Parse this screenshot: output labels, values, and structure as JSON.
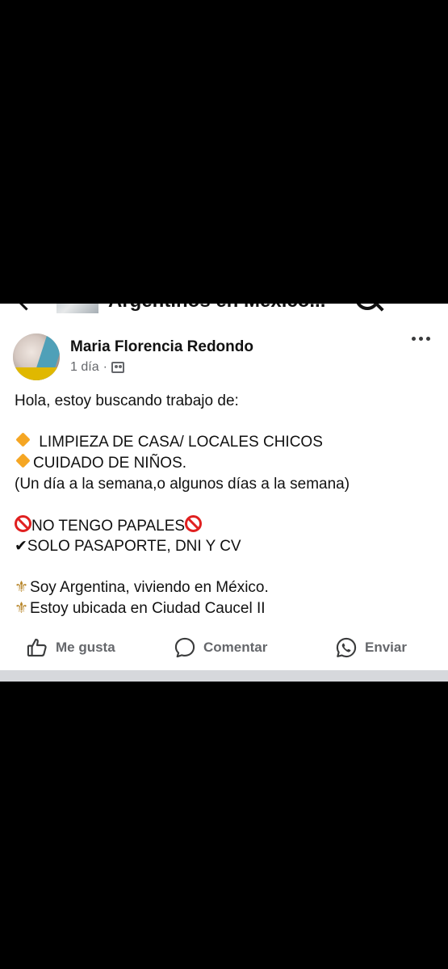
{
  "group": {
    "name": "Argentinos en México..."
  },
  "post": {
    "author": "Maria Florencia Redondo",
    "time": "1 día",
    "separator": "·",
    "body_lines": {
      "intro": "Hola, estoy buscando trabajo de:",
      "item1": "LIMPIEZA DE CASA/ LOCALES CHICOS",
      "item2": "CUIDADO DE NIÑOS.",
      "schedule": "(Un día a la semana,o algunos días a la semana)",
      "no_papers": "NO TENGO PAPALES",
      "docs_mark": "✔",
      "docs": "SOLO PASAPORTE, DNI Y CV",
      "fleur1": "⚜",
      "origin": "Soy Argentina, viviendo en México.",
      "fleur2": "⚜",
      "location": "Estoy ubicada en Ciudad Caucel II"
    }
  },
  "actions": {
    "like": "Me gusta",
    "comment": "Comentar",
    "send": "Enviar"
  },
  "colors": {
    "text": "#111111",
    "secondary": "#65676b",
    "orange_diamond": "#f5a623",
    "no_entry_red": "#e02020",
    "divider": "#d6d8dc"
  },
  "icons": {
    "like": "thumbs-up-icon",
    "comment": "comment-bubble-icon",
    "send": "whatsapp-icon",
    "more": "more-horizontal-icon",
    "group": "group-icon",
    "back": "chevron-left-icon",
    "search": "search-icon"
  }
}
